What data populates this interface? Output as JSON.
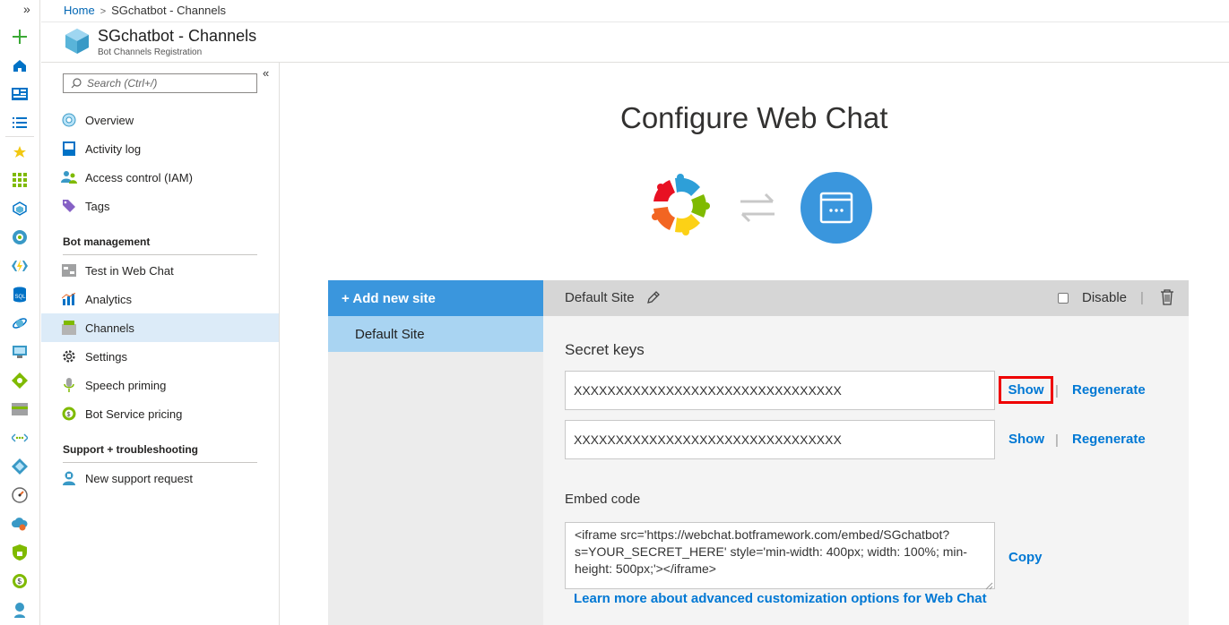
{
  "breadcrumb": {
    "home": "Home",
    "current": "SGchatbot - Channels"
  },
  "header": {
    "title": "SGchatbot - Channels",
    "subtitle": "Bot Channels Registration"
  },
  "search": {
    "placeholder": "Search (Ctrl+/)"
  },
  "menu": {
    "items_top": [
      {
        "label": "Overview",
        "icon": "globe-icon"
      },
      {
        "label": "Activity log",
        "icon": "activity-log-icon"
      },
      {
        "label": "Access control (IAM)",
        "icon": "people-icon"
      },
      {
        "label": "Tags",
        "icon": "tag-icon"
      }
    ],
    "section_bot": "Bot management",
    "items_bot": [
      {
        "label": "Test in Web Chat",
        "icon": "webchat-icon"
      },
      {
        "label": "Analytics",
        "icon": "analytics-icon"
      },
      {
        "label": "Channels",
        "icon": "channels-icon",
        "active": true
      },
      {
        "label": "Settings",
        "icon": "gear-icon"
      },
      {
        "label": "Speech priming",
        "icon": "microphone-icon"
      },
      {
        "label": "Bot Service pricing",
        "icon": "pricing-icon"
      }
    ],
    "section_support": "Support + troubleshooting",
    "items_support": [
      {
        "label": "New support request",
        "icon": "support-icon"
      }
    ]
  },
  "configure": {
    "title": "Configure Web Chat",
    "add_site": "+ Add new site",
    "site_list": [
      "Default Site"
    ],
    "site_name": "Default Site",
    "disable_label": "Disable",
    "secret_keys_label": "Secret keys",
    "keys": [
      {
        "value": "XXXXXXXXXXXXXXXXXXXXXXXXXXXXXXXX",
        "show": "Show",
        "regenerate": "Regenerate"
      },
      {
        "value": "XXXXXXXXXXXXXXXXXXXXXXXXXXXXXXXX",
        "show": "Show",
        "regenerate": "Regenerate"
      }
    ],
    "embed_label": "Embed code",
    "embed_code": "<iframe src='https://webchat.botframework.com/embed/SGchatbot?s=YOUR_SECRET_HERE'  style='min-width: 400px; width: 100%; min-height: 500px;'></iframe>",
    "copy": "Copy",
    "learn_more": "Learn more about advanced customization options for Web Chat",
    "separator": "|"
  },
  "colors": {
    "accent": "#3a96dd",
    "link": "#0078d4",
    "highlight": "#e00000"
  }
}
